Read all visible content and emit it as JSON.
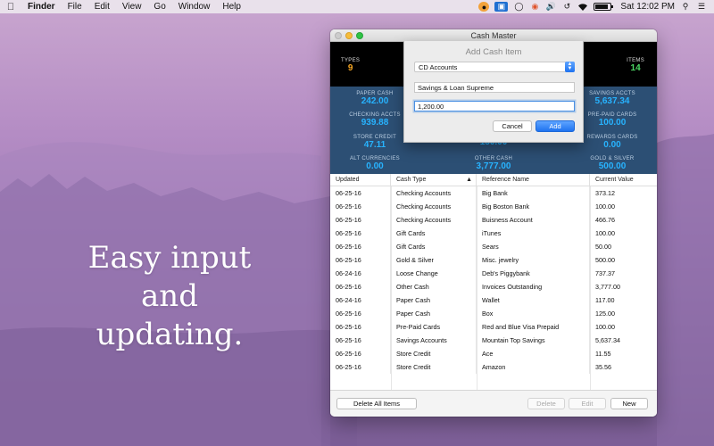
{
  "menubar": {
    "apple_icon": "apple-icon",
    "app_name": "Finder",
    "items": [
      "File",
      "Edit",
      "View",
      "Go",
      "Window",
      "Help"
    ],
    "clock": "Sat 12:02 PM"
  },
  "tagline": [
    "Easy input",
    "and",
    "updating."
  ],
  "window": {
    "title": "Cash Master",
    "stats": {
      "types_label": "TYPES",
      "types_value": "9",
      "items_label": "ITEMS",
      "items_value": "14"
    },
    "categories": [
      {
        "label": "PAPER CASH",
        "value": "242.00"
      },
      {
        "label": "SAVINGS ACCTS",
        "value": "5,637.34"
      },
      {
        "label": "CHECKING ACCTS",
        "value": "939.88"
      },
      {
        "label": "PRE-PAID CARDS",
        "value": "100.00"
      },
      {
        "label": "STORE CREDIT",
        "value": "47.11"
      },
      {
        "label": "REWARDS CARDS",
        "value": "0.00"
      },
      {
        "label": "",
        "value": "150.00"
      },
      {
        "label": "ALT CURRENCIES",
        "value": "0.00"
      },
      {
        "label": "OTHER CASH",
        "value": "3,777.00"
      },
      {
        "label": "GOLD & SILVER",
        "value": "500.00"
      }
    ],
    "table": {
      "headers": [
        "Updated",
        "Cash Type",
        "Reference Name",
        "Current Value"
      ],
      "rows": [
        [
          "06-25-16",
          "Checking Accounts",
          "Big Bank",
          "373.12"
        ],
        [
          "06-25-16",
          "Checking Accounts",
          "Big Boston Bank",
          "100.00"
        ],
        [
          "06-25-16",
          "Checking Accounts",
          "Buisness Account",
          "466.76"
        ],
        [
          "06-25-16",
          "Gift Cards",
          "iTunes",
          "100.00"
        ],
        [
          "06-25-16",
          "Gift Cards",
          "Sears",
          "50.00"
        ],
        [
          "06-25-16",
          "Gold & Silver",
          "Misc. jewelry",
          "500.00"
        ],
        [
          "06-24-16",
          "Loose Change",
          "Deb's Piggybank",
          "737.37"
        ],
        [
          "06-25-16",
          "Other Cash",
          "Invoices Outstanding",
          "3,777.00"
        ],
        [
          "06-24-16",
          "Paper Cash",
          "Wallet",
          "117.00"
        ],
        [
          "06-25-16",
          "Paper Cash",
          "Box",
          "125.00"
        ],
        [
          "06-25-16",
          "Pre-Paid Cards",
          "Red and Blue Visa Prepaid",
          "100.00"
        ],
        [
          "06-25-16",
          "Savings Accounts",
          "Mountain Top Savings",
          "5,637.34"
        ],
        [
          "06-25-16",
          "Store Credit",
          "Ace",
          "11.55"
        ],
        [
          "06-25-16",
          "Store Credit",
          "Amazon",
          "35.56"
        ]
      ]
    },
    "footer": {
      "delete_all": "Delete All Items",
      "delete": "Delete",
      "edit": "Edit",
      "new": "New"
    },
    "dialog": {
      "heading": "Add Cash Item",
      "cash_type": "CD Accounts",
      "reference_name": "Savings & Loan Supreme",
      "value": "1,200.00",
      "cancel": "Cancel",
      "add": "Add"
    }
  },
  "colors": {
    "dash_bg": "#2c4f74",
    "value_blue": "#27b3ff",
    "types_orange": "#f5a623",
    "items_green": "#4cd964"
  }
}
